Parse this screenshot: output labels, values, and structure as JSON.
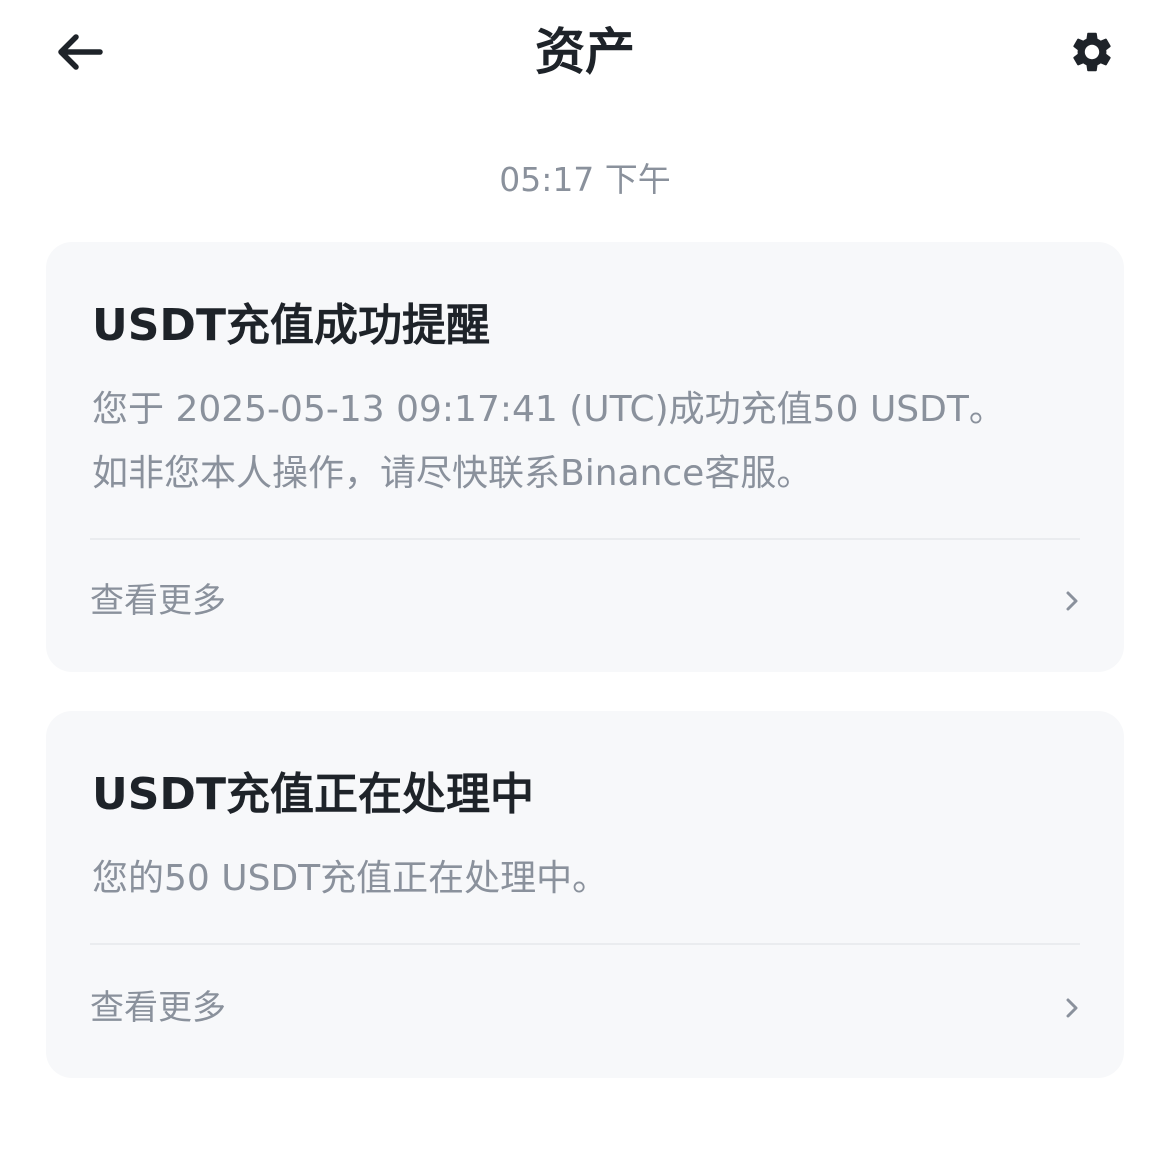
{
  "header": {
    "title": "资产",
    "back_icon": "arrow-left-icon",
    "settings_icon": "gear-icon"
  },
  "timestamp": "05:17 下午",
  "notifications": [
    {
      "title": "USDT充值成功提醒",
      "body_line1": "您于 2025-05-13 09:17:41 (UTC)成功充值50 USDT。",
      "body_line2": "如非您本人操作，请尽快联系Binance客服。",
      "link_label": "查看更多",
      "link_icon": "chevron-right-icon"
    },
    {
      "title": "USDT充值正在处理中",
      "body_line1": "您的50 USDT充值正在处理中。",
      "link_label": "查看更多",
      "link_icon": "chevron-right-icon"
    }
  ],
  "colors": {
    "primary_text": "#1e2329",
    "secondary_text": "#8a919c",
    "card_background": "#f7f8fa",
    "divider": "#eaecef"
  }
}
